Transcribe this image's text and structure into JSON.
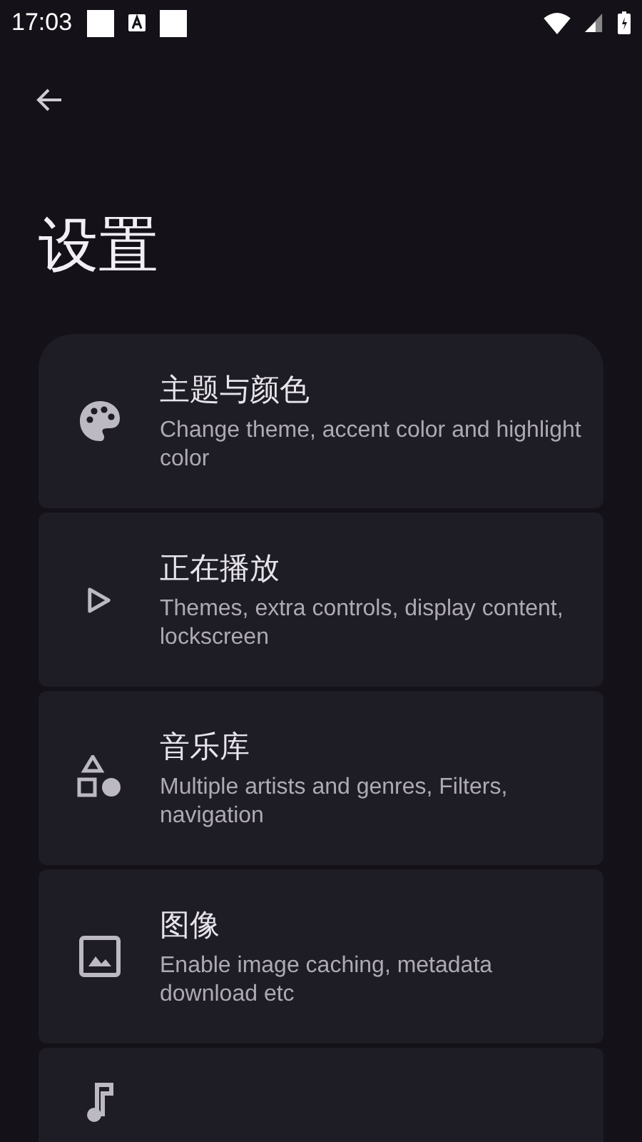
{
  "status_bar": {
    "time": "17:03"
  },
  "title": "设置",
  "items": [
    {
      "kind": "setting",
      "title": "主题与颜色",
      "subtitle": "Change theme, accent color and highlight color"
    },
    {
      "kind": "setting",
      "title": "正在播放",
      "subtitle": "Themes, extra controls, display content, lockscreen"
    },
    {
      "kind": "setting",
      "title": "音乐库",
      "subtitle": "Multiple artists and genres, Filters, navigation"
    },
    {
      "kind": "setting",
      "title": "图像",
      "subtitle": "Enable image caching, metadata download etc"
    },
    {
      "kind": "setting"
    }
  ]
}
